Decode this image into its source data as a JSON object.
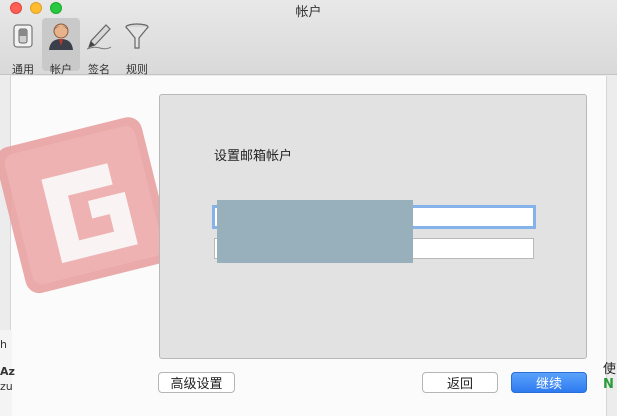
{
  "window": {
    "title": "帐户"
  },
  "toolbar": {
    "items": [
      {
        "label": "通用",
        "icon": "switch-icon"
      },
      {
        "label": "帐户",
        "icon": "user-icon",
        "active": true
      },
      {
        "label": "签名",
        "icon": "pen-icon"
      },
      {
        "label": "规则",
        "icon": "funnel-icon"
      }
    ]
  },
  "sheet": {
    "title": "设置邮箱帐户",
    "field1": {
      "value": "",
      "placeholder": ""
    },
    "field2": {
      "value": "",
      "placeholder": ""
    }
  },
  "buttons": {
    "advanced": "高级设置",
    "back": "返回",
    "continue": "继续"
  },
  "background": {
    "left_fragments": [
      "h",
      "Az",
      "zu"
    ],
    "right_fragments": [
      "使",
      "N"
    ]
  },
  "colors": {
    "accent": "#2e7bf0",
    "focus_ring": "#86b2ea",
    "logo": "#e8a1a1"
  }
}
